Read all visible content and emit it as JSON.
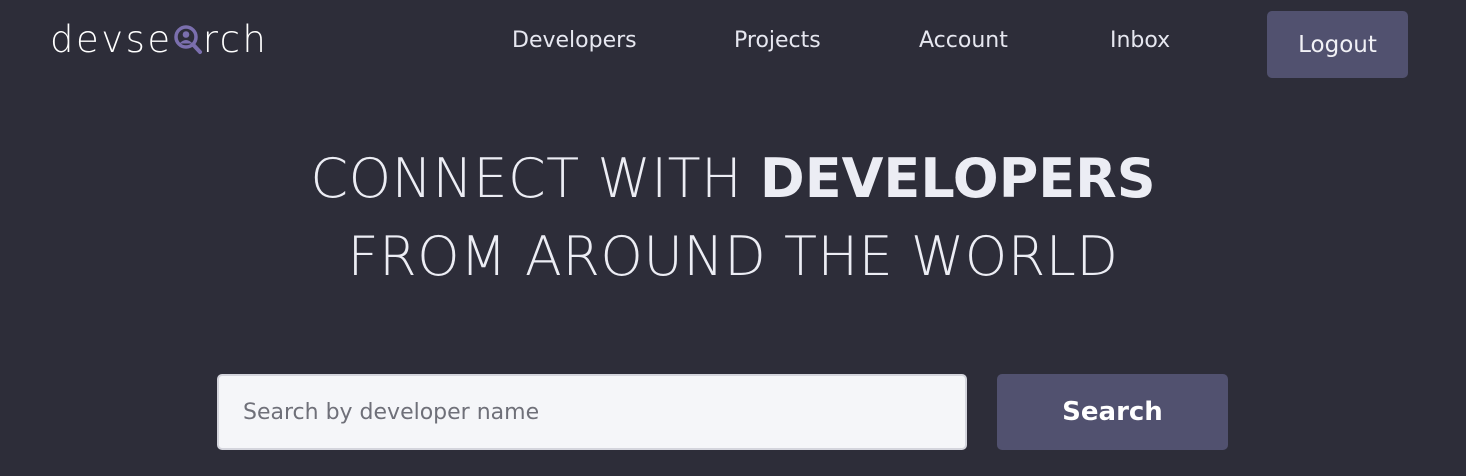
{
  "logo": {
    "text_before": "devse",
    "text_after": "rch"
  },
  "nav": {
    "links": [
      {
        "label": "Developers"
      },
      {
        "label": "Projects"
      },
      {
        "label": "Account"
      },
      {
        "label": "Inbox"
      }
    ],
    "logout_label": "Logout"
  },
  "hero": {
    "line1_regular": "CONNECT WITH ",
    "line1_bold": "DEVELOPERS",
    "line2": "FROM AROUND THE WORLD"
  },
  "search": {
    "placeholder": "Search by developer name",
    "value": "",
    "button_label": "Search"
  },
  "colors": {
    "background": "#2d2d39",
    "accent": "#51516f",
    "logo_icon": "#7b6fae"
  },
  "icons": {
    "logo_icon": "magnifier-user-icon"
  }
}
